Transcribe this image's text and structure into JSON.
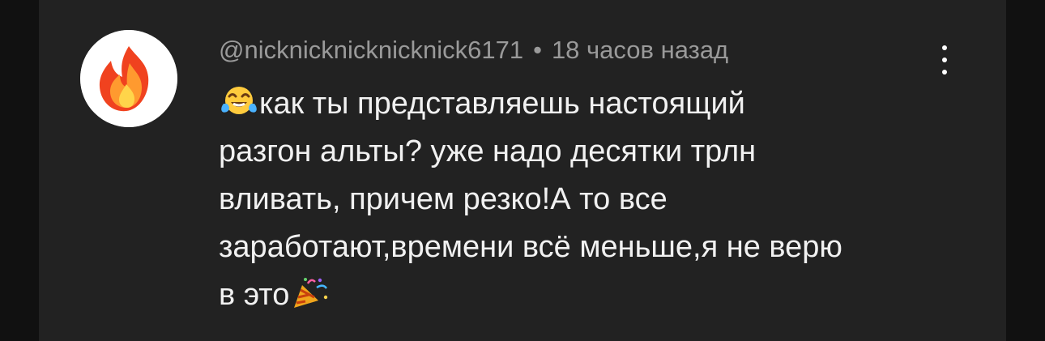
{
  "comment": {
    "author": "@nicknicknicknicknick6171",
    "separator": "•",
    "time_ago": "18 часов назад",
    "lines": [
      "как ты представляешь настоящий",
      "разгон альты? уже надо десятки трлн",
      "вливать, причем резко!А то все",
      "заработают,времени всё меньше,я не верю",
      "в это"
    ],
    "avatar_icon": "fire-icon",
    "leading_emoji": "laughing-tears-emoji-icon",
    "trailing_emoji": "party-popper-emoji-icon",
    "menu_icon": "more-vertical-icon"
  },
  "colors": {
    "background": "#222222",
    "outer_background": "#111111",
    "text": "#f1f1f1",
    "meta_text": "#9a9a9a"
  }
}
